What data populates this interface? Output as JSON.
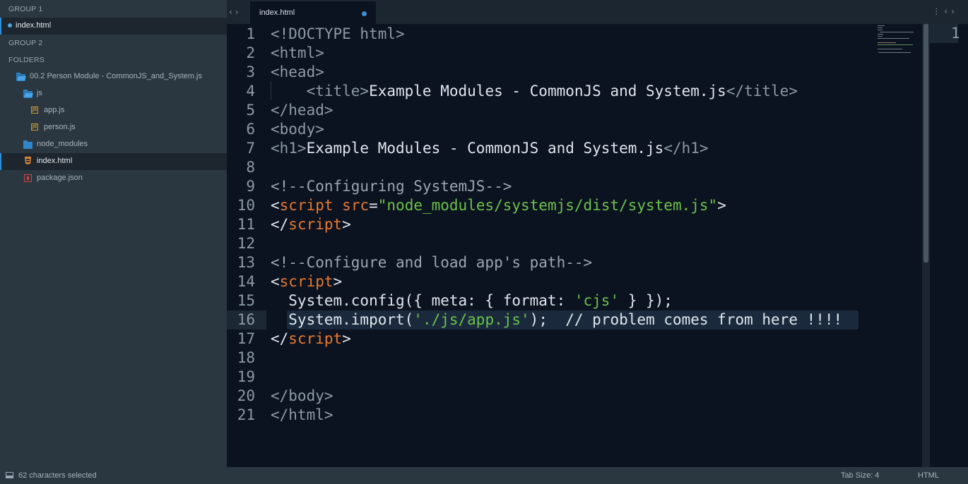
{
  "sidebar": {
    "group1_label": "GROUP 1",
    "group1_file": "index.html",
    "group2_label": "GROUP 2",
    "folders_label": "FOLDERS",
    "root_folder": "00.2 Person Module -  CommonJS_and_System.js",
    "js_folder": "js",
    "app_js": "app.js",
    "person_js": "person.js",
    "node_modules": "node_modules",
    "index_html": "index.html",
    "package_json": "package.json"
  },
  "tab": {
    "label": "index.html"
  },
  "editor": {
    "line_numbers": [
      "1",
      "2",
      "3",
      "4",
      "5",
      "6",
      "7",
      "8",
      "9",
      "10",
      "11",
      "12",
      "13",
      "14",
      "15",
      "16",
      "17",
      "18",
      "19",
      "20",
      "21"
    ],
    "current_line": 16,
    "lines": [
      [
        {
          "t": "<!DOCTYPE html>",
          "c": "tag"
        }
      ],
      [
        {
          "t": "<html>",
          "c": "tag"
        }
      ],
      [
        {
          "t": "<head>",
          "c": "tag"
        }
      ],
      [
        {
          "t": "    <title>",
          "c": "tag"
        },
        {
          "t": "Example Modules - CommonJS and System.js",
          "c": "txt"
        },
        {
          "t": "</title>",
          "c": "tag"
        }
      ],
      [
        {
          "t": "</head>",
          "c": "tag"
        }
      ],
      [
        {
          "t": "<body>",
          "c": "tag"
        }
      ],
      [
        {
          "t": "<h1>",
          "c": "tag"
        },
        {
          "t": "Example Modules - CommonJS and System.js",
          "c": "txt"
        },
        {
          "t": "</h1>",
          "c": "tag"
        }
      ],
      [],
      [
        {
          "t": "<!--Configuring SystemJS-->",
          "c": "cmt"
        }
      ],
      [
        {
          "t": "<",
          "c": "def"
        },
        {
          "t": "script",
          "c": "kw"
        },
        {
          "t": " ",
          "c": "def"
        },
        {
          "t": "src",
          "c": "kw"
        },
        {
          "t": "=",
          "c": "def"
        },
        {
          "t": "\"node_modules/systemjs/dist/system.js\"",
          "c": "str"
        },
        {
          "t": ">",
          "c": "def"
        }
      ],
      [
        {
          "t": "</",
          "c": "def"
        },
        {
          "t": "script",
          "c": "kw"
        },
        {
          "t": ">",
          "c": "def"
        }
      ],
      [],
      [
        {
          "t": "<!--Configure and load app's path-->",
          "c": "cmt"
        }
      ],
      [
        {
          "t": "<",
          "c": "def"
        },
        {
          "t": "script",
          "c": "kw"
        },
        {
          "t": ">",
          "c": "def"
        }
      ],
      [
        {
          "t": "  System.config({ meta: { format: ",
          "c": "def"
        },
        {
          "t": "'cjs'",
          "c": "str"
        },
        {
          "t": " } });",
          "c": "def"
        }
      ],
      [
        {
          "t": "  System.import(",
          "c": "def"
        },
        {
          "t": "'./js/app.js'",
          "c": "str"
        },
        {
          "t": ");  // problem comes from here !!!!",
          "c": "def"
        }
      ],
      [
        {
          "t": "</",
          "c": "def"
        },
        {
          "t": "script",
          "c": "kw"
        },
        {
          "t": ">",
          "c": "def"
        }
      ],
      [],
      [],
      [
        {
          "t": "</body>",
          "c": "tag"
        }
      ],
      [
        {
          "t": "</html>",
          "c": "tag"
        }
      ]
    ]
  },
  "pane2": {
    "line_number": "1"
  },
  "status": {
    "selection": "62 characters selected",
    "tab_size": "Tab Size: 4",
    "syntax": "HTML"
  },
  "colors": {
    "tag": "#8d9aa5",
    "keyword": "#e87a2e",
    "string": "#6cc24a",
    "accent": "#2e8fd8"
  }
}
